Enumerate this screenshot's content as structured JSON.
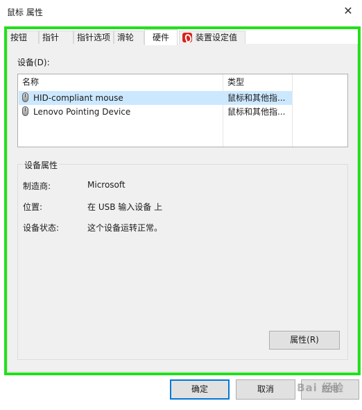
{
  "window": {
    "title": "鼠标 属性",
    "close_glyph": "✕"
  },
  "tabs": [
    {
      "label": "按钮"
    },
    {
      "label": "指针"
    },
    {
      "label": "指针选项"
    },
    {
      "label": "滑轮"
    },
    {
      "label": "硬件",
      "active": true
    },
    {
      "label": "装置设定值",
      "icon": "device-settings-icon"
    }
  ],
  "hardware": {
    "devices_label": "设备(D):",
    "columns": [
      "名称",
      "类型"
    ],
    "rows": [
      {
        "name": "HID-compliant mouse",
        "type": "鼠标和其他指...",
        "selected": true,
        "icon": "mouse-icon"
      },
      {
        "name": "Lenovo Pointing Device",
        "type": "鼠标和其他指...",
        "icon": "mouse-icon"
      }
    ],
    "group_title": "设备属性",
    "props": [
      {
        "label": "制造商:",
        "value": "Microsoft"
      },
      {
        "label": "位置:",
        "value": "在 USB 输入设备 上"
      },
      {
        "label": "设备状态:",
        "value": "这个设备运转正常。"
      }
    ],
    "properties_button": "属性(R)"
  },
  "footer": {
    "ok_button": "确定",
    "cancel_button": "取消",
    "apply_button": "应用"
  },
  "watermark": "Bai 经验",
  "colors": {
    "highlight": "#22e01a",
    "selection": "#cce8ff",
    "default_button_border": "#0078d7"
  }
}
